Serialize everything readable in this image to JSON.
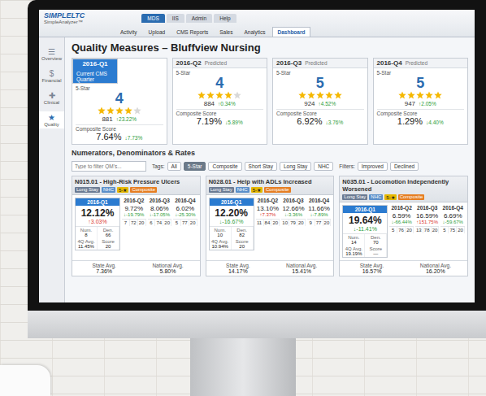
{
  "app": {
    "logo": "SIMPLELTC",
    "product": "SimpleAnalyzer™"
  },
  "top_tabs": [
    {
      "label": "MDS",
      "selected": true
    },
    {
      "label": "IIS",
      "selected": false
    },
    {
      "label": "Admin",
      "selected": false
    },
    {
      "label": "Help",
      "selected": false
    }
  ],
  "sub_nav": [
    {
      "label": "Activity",
      "selected": false
    },
    {
      "label": "Upload",
      "selected": false
    },
    {
      "label": "CMS Reports",
      "selected": false
    },
    {
      "label": "Sales",
      "selected": false
    },
    {
      "label": "Analytics",
      "selected": false
    },
    {
      "label": "Dashboard",
      "selected": true
    }
  ],
  "sidebar": {
    "items": [
      {
        "icon": "☰",
        "label": "Overview",
        "selected": false
      },
      {
        "icon": "$",
        "label": "Financial",
        "selected": false
      },
      {
        "icon": "✚",
        "label": "Clinical",
        "selected": false
      },
      {
        "icon": "★",
        "label": "Quality",
        "selected": true
      }
    ]
  },
  "page": {
    "title": "Quality Measures – Bluffview Nursing"
  },
  "quarters": [
    {
      "quarter": "2016-Q1",
      "status": "Current CMS Quarter",
      "current": true,
      "rating_label": "5-Star",
      "rating": "4",
      "stars": 4,
      "score": "881",
      "score_change": {
        "text": "↑23.22%",
        "good": true
      },
      "composite_label": "Composite Score",
      "composite": "7.64%",
      "composite_change": {
        "text": "↓7.73%",
        "good": true
      }
    },
    {
      "quarter": "2016-Q2",
      "status": "Predicted",
      "current": false,
      "rating_label": "5-Star",
      "rating": "4",
      "stars": 4,
      "score": "884",
      "score_change": {
        "text": "↑0.34%",
        "good": true
      },
      "composite_label": "Composite Score",
      "composite": "7.19%",
      "composite_change": {
        "text": "↓5.89%",
        "good": true
      }
    },
    {
      "quarter": "2016-Q3",
      "status": "Predicted",
      "current": false,
      "rating_label": "5-Star",
      "rating": "5",
      "stars": 5,
      "score": "924",
      "score_change": {
        "text": "↑4.52%",
        "good": true
      },
      "composite_label": "Composite Score",
      "composite": "6.92%",
      "composite_change": {
        "text": "↓3.76%",
        "good": true
      }
    },
    {
      "quarter": "2016-Q4",
      "status": "Predicted",
      "current": false,
      "rating_label": "5-Star",
      "rating": "5",
      "stars": 5,
      "score": "947",
      "score_change": {
        "text": "↑2.05%",
        "good": true
      },
      "composite_label": "Composite Score",
      "composite": "1.29%",
      "composite_change": {
        "text": "↓4.40%",
        "good": true
      }
    }
  ],
  "section_title": "Numerators, Denominators & Rates",
  "search": {
    "placeholder": "Type to filter QM's..."
  },
  "tags": {
    "label": "Tags:",
    "items": [
      {
        "label": "All",
        "selected": false
      },
      {
        "label": "5-Star",
        "selected": true
      },
      {
        "label": "Composite",
        "selected": false
      },
      {
        "label": "Short Stay",
        "selected": false
      },
      {
        "label": "Long Stay",
        "selected": false
      },
      {
        "label": "NHC",
        "selected": false
      }
    ]
  },
  "filters": {
    "label": "Filters:",
    "items": [
      {
        "label": "Improved",
        "selected": false
      },
      {
        "label": "Declined",
        "selected": false
      }
    ]
  },
  "measures": [
    {
      "title": "N015.01 - High-Risk Pressure Ulcers",
      "tags": [
        {
          "label": "Long Stay",
          "color": "#6b7b93"
        },
        {
          "label": "NHC",
          "color": "#5b8fc9"
        },
        {
          "label": "5-★",
          "color": "#e6b800"
        },
        {
          "label": "Composite",
          "color": "#e67e22"
        }
      ],
      "current": {
        "quarter": "2016-Q1",
        "rate": "12.12%",
        "change": {
          "text": "↑3.03%",
          "good": false
        },
        "stats": [
          {
            "label": "Num.",
            "value": "8"
          },
          {
            "label": "Den.",
            "value": "66"
          },
          {
            "label": "4Q Avg.",
            "value": "11.45%"
          },
          {
            "label": "Score",
            "value": "20"
          }
        ]
      },
      "forecasts": [
        {
          "quarter": "2016-Q2",
          "rate": "9.72%",
          "change": {
            "text": "↓-19.79%",
            "good": true
          },
          "cells": [
            "7",
            "72",
            "20"
          ]
        },
        {
          "quarter": "2016-Q3",
          "rate": "8.06%",
          "change": {
            "text": "↓-17.05%",
            "good": true
          },
          "cells": [
            "6",
            "74",
            "20"
          ]
        },
        {
          "quarter": "2016-Q4",
          "rate": "6.02%",
          "change": {
            "text": "↓-25.30%",
            "good": true
          },
          "cells": [
            "5",
            "77",
            "20"
          ]
        }
      ],
      "footer": [
        {
          "label": "State Avg.",
          "value": "7.36%"
        },
        {
          "label": "National Avg.",
          "value": "5.80%"
        }
      ]
    },
    {
      "title": "N028.01 - Help with ADLs Increased",
      "tags": [
        {
          "label": "Long Stay",
          "color": "#6b7b93"
        },
        {
          "label": "NHC",
          "color": "#5b8fc9"
        },
        {
          "label": "5-★",
          "color": "#e6b800"
        },
        {
          "label": "Composite",
          "color": "#e67e22"
        }
      ],
      "current": {
        "quarter": "2016-Q1",
        "rate": "12.20%",
        "change": {
          "text": "↓-16.67%",
          "good": true
        },
        "stats": [
          {
            "label": "Num.",
            "value": "10"
          },
          {
            "label": "Den.",
            "value": "82"
          },
          {
            "label": "4Q Avg.",
            "value": "10.94%"
          },
          {
            "label": "Score",
            "value": "20"
          }
        ]
      },
      "forecasts": [
        {
          "quarter": "2016-Q2",
          "rate": "13.10%",
          "change": {
            "text": "↑7.37%",
            "good": false
          },
          "cells": [
            "11",
            "84",
            "20"
          ]
        },
        {
          "quarter": "2016-Q3",
          "rate": "12.66%",
          "change": {
            "text": "↓-3.36%",
            "good": true
          },
          "cells": [
            "10",
            "79",
            "20"
          ]
        },
        {
          "quarter": "2016-Q4",
          "rate": "11.66%",
          "change": {
            "text": "↓-7.89%",
            "good": true
          },
          "cells": [
            "9",
            "77",
            "20"
          ]
        }
      ],
      "footer": [
        {
          "label": "State Avg.",
          "value": "14.17%"
        },
        {
          "label": "National Avg.",
          "value": "15.41%"
        }
      ]
    },
    {
      "title": "N035.01 - Locomotion Independently Worsened",
      "tags": [
        {
          "label": "Long Stay",
          "color": "#6b7b93"
        },
        {
          "label": "NHC",
          "color": "#5b8fc9"
        },
        {
          "label": "5-★",
          "color": "#e6b800"
        },
        {
          "label": "Composite",
          "color": "#e67e22"
        }
      ],
      "current": {
        "quarter": "2016-Q1",
        "rate": "19.64%",
        "change": {
          "text": "↓-11.41%",
          "good": true
        },
        "stats": [
          {
            "label": "Num.",
            "value": "14"
          },
          {
            "label": "Den.",
            "value": "70"
          },
          {
            "label": "4Q Avg.",
            "value": "19.19%"
          },
          {
            "label": "Score",
            "value": "—"
          }
        ]
      },
      "forecasts": [
        {
          "quarter": "2016-Q2",
          "rate": "6.59%",
          "change": {
            "text": "↓-66.44%",
            "good": true
          },
          "cells": [
            "5",
            "76",
            "20"
          ]
        },
        {
          "quarter": "2016-Q3",
          "rate": "16.59%",
          "change": {
            "text": "↑151.75%",
            "good": false
          },
          "cells": [
            "13",
            "78",
            "20"
          ]
        },
        {
          "quarter": "2016-Q4",
          "rate": "6.69%",
          "change": {
            "text": "↓-59.67%",
            "good": true
          },
          "cells": [
            "5",
            "75",
            "20"
          ]
        }
      ],
      "footer": [
        {
          "label": "State Avg.",
          "value": "16.57%"
        },
        {
          "label": "National Avg.",
          "value": "16.20%"
        }
      ]
    }
  ]
}
